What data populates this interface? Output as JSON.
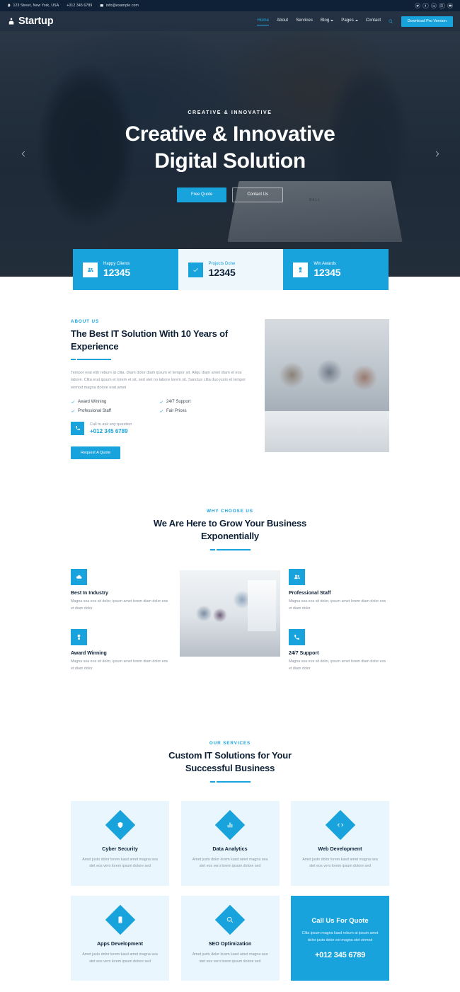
{
  "topbar": {
    "address": "123 Street, New York, USA",
    "phone": "+012 345 6789",
    "email": "info@example.com",
    "socials": [
      {
        "name": "twitter-icon"
      },
      {
        "name": "facebook-icon"
      },
      {
        "name": "linkedin-icon"
      },
      {
        "name": "instagram-icon"
      },
      {
        "name": "youtube-icon"
      }
    ]
  },
  "nav": {
    "brand": "Startup",
    "links": [
      {
        "label": "Home",
        "active": true,
        "caret": false
      },
      {
        "label": "About",
        "active": false,
        "caret": false
      },
      {
        "label": "Services",
        "active": false,
        "caret": false
      },
      {
        "label": "Blog",
        "active": false,
        "caret": true
      },
      {
        "label": "Pages",
        "active": false,
        "caret": true
      },
      {
        "label": "Contact",
        "active": false,
        "caret": false
      }
    ],
    "cta_label": "Download Pro Version"
  },
  "hero": {
    "kicker": "CREATIVE & INNOVATIVE",
    "title_line1": "Creative & Innovative",
    "title_line2": "Digital Solution",
    "primary_button": "Free Quote",
    "secondary_button": "Contact Us"
  },
  "facts": [
    {
      "label": "Happy Clients",
      "value": "12345",
      "icon": "users-icon",
      "style": "solid"
    },
    {
      "label": "Projects Done",
      "value": "12345",
      "icon": "check-icon",
      "style": "light"
    },
    {
      "label": "Win Awards",
      "value": "12345",
      "icon": "award-icon",
      "style": "solid"
    }
  ],
  "about": {
    "kicker": "ABOUT US",
    "title": "The Best IT Solution With 10 Years of Experience",
    "paragraph": "Tempor erat elitr rebum at clita. Diam dolor diam ipsum et tempor sit. Aliqu diam amet diam et eos labore. Clita erat ipsum et lorem et sit, sed stet no labore lorem sit. Sanctus clita duo justo et tempor eirmod magna dolore erat amet",
    "checks": [
      "Award Winning",
      "24/7 Support",
      "Professional Staff",
      "Fair Prices"
    ],
    "call_label": "Call to ask any question",
    "call_phone": "+012 345 6789",
    "button": "Request A Quote"
  },
  "why": {
    "kicker": "WHY CHOOSE US",
    "title": "We Are Here to Grow Your Business Exponentially",
    "left_items": [
      {
        "title": "Best In Industry",
        "text": "Magna sea eos sit dolor, ipsum amet lorem diam dolor eos et diam dolor",
        "icon": "cloud-icon"
      },
      {
        "title": "Award Winning",
        "text": "Magna sea eos sit dolor, ipsum amet lorem diam dolor eos et diam dolor",
        "icon": "award-icon"
      }
    ],
    "right_items": [
      {
        "title": "Professional Staff",
        "text": "Magna sea eos sit dolor, ipsum amet lorem diam dolor eos et diam dolor",
        "icon": "users-icon"
      },
      {
        "title": "24/7 Support",
        "text": "Magna sea eos sit dolor, ipsum amet lorem diam dolor eos et diam dolor",
        "icon": "phone-icon"
      }
    ]
  },
  "services": {
    "kicker": "OUR SERVICES",
    "title": "Custom IT Solutions for Your Successful Business",
    "items": [
      {
        "title": "Cyber Security",
        "text": "Amet justo dolor lorem kasd amet magna sea stet eos vero lorem ipsum dolore sed",
        "icon": "shield-icon"
      },
      {
        "title": "Data Analytics",
        "text": "Amet justo dolor lorem kasd amet magna sea stet eos vero lorem ipsum dolore sed",
        "icon": "chart-icon"
      },
      {
        "title": "Web Development",
        "text": "Amet justo dolor lorem kasd amet magna sea stet eos vero lorem ipsum dolore sed",
        "icon": "code-icon"
      },
      {
        "title": "Apps Development",
        "text": "Amet justo dolor lorem kasd amet magna sea stet eos vero lorem ipsum dolore sed",
        "icon": "mobile-icon"
      },
      {
        "title": "SEO Optimization",
        "text": "Amet justo dolor lorem kasd amet magna sea stet eos vero lorem ipsum dolore sed",
        "icon": "search-icon"
      }
    ],
    "cta": {
      "title": "Call Us For Quote",
      "text": "Clita ipsum magna kasd rebum at ipsum amet dolor justo dolor est magna stet eirmod",
      "phone": "+012 345 6789"
    }
  },
  "colors": {
    "accent": "#19a3dd",
    "dark": "#0f2137",
    "light_panel": "#e9f6fd",
    "muted_text": "#8a93a0"
  }
}
